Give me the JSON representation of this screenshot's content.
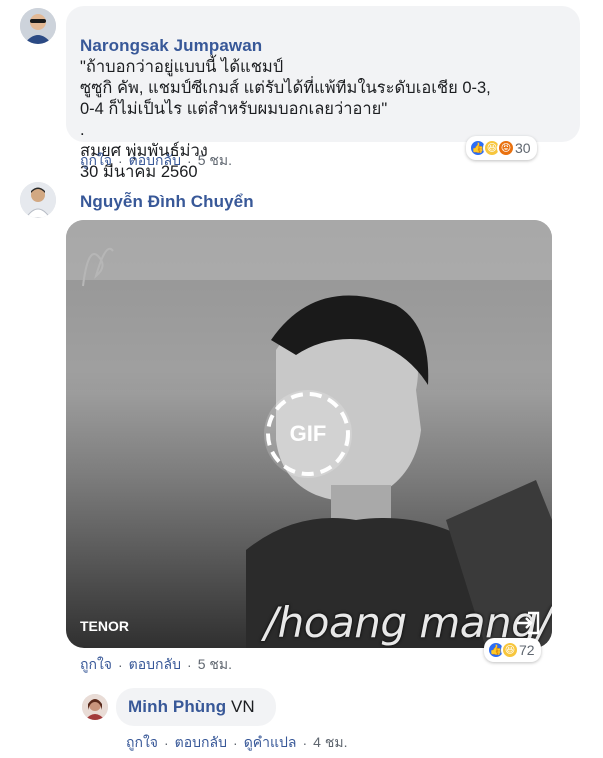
{
  "comments": [
    {
      "author": "Narongsak Jumpawan",
      "text_line1": "\"ถ้าบอกว่าอยู่แบบนี้ ได้แชมป์",
      "text_line2": "ซูซูกิ คัพ, แชมป์ซีเกมส์ แต่รับได้ที่แพ้ทีมในระดับเอเชีย 0-3,",
      "text_line3": "0-4 ก็ไม่เป็นไร แต่สำหรับผมบอกเลยว่าอาย\"",
      "text_line4": ".",
      "text_line5": "สมยศ พุ่มพันธ์ม่วง",
      "text_line6": "30 มีนาคม 2560",
      "like_label": "ถูกใจ",
      "reply_label": "ตอบกลับ",
      "time": "5 ชม.",
      "reaction_count": "30"
    },
    {
      "author": "Nguyễn Đình Chuyển",
      "gif_caption": "/hoang mang/",
      "gif_badge": "GIF",
      "gif_provider": "TENOR",
      "like_label": "ถูกใจ",
      "reply_label": "ตอบกลับ",
      "time": "5 ชม.",
      "reaction_count": "72"
    }
  ],
  "reply": {
    "author": "Minh Phùng",
    "text": "VN",
    "like_label": "ถูกใจ",
    "reply_label": "ตอบกลับ",
    "translate_label": "ดูคำแปล",
    "time": "4 ชม."
  },
  "separator": "·",
  "colors": {
    "link": "#385898",
    "bubble": "#f2f3f5",
    "meta": "#606770",
    "like": "#2d6ef6",
    "haha": "#f7c63d",
    "angry": "#e9710f"
  }
}
